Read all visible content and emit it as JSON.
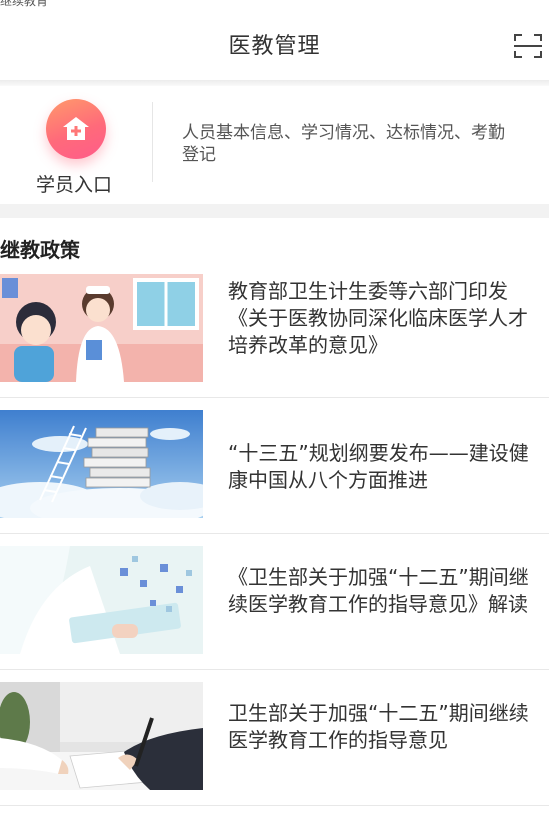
{
  "status_bar": {
    "text": "继续教育"
  },
  "header": {
    "title": "医教管理",
    "scan_icon": "scan-icon"
  },
  "student_entry": {
    "label": "学员入口",
    "description": "人员基本信息、学习情况、达标情况、考勤登记",
    "icon": "hospital-icon",
    "icon_colors": [
      "#ff9a6b",
      "#ff5c8a"
    ]
  },
  "policy_section": {
    "title": "继教政策",
    "items": [
      {
        "title": "教育部卫生计生委等六部门印发《关于医教协同深化临床医学人才培养改革的意见》",
        "image": "nurse-illustration"
      },
      {
        "title": "“十三五”规划纲要发布——建设健康中国从八个方面推进",
        "image": "books-in-clouds"
      },
      {
        "title": "《卫生部关于加强“十二五”期间继续医学教育工作的指导意见》解读",
        "image": "doctor-tablet"
      },
      {
        "title": "卫生部关于加强“十二五”期间继续医学教育工作的指导意见",
        "image": "signing-document"
      }
    ]
  }
}
